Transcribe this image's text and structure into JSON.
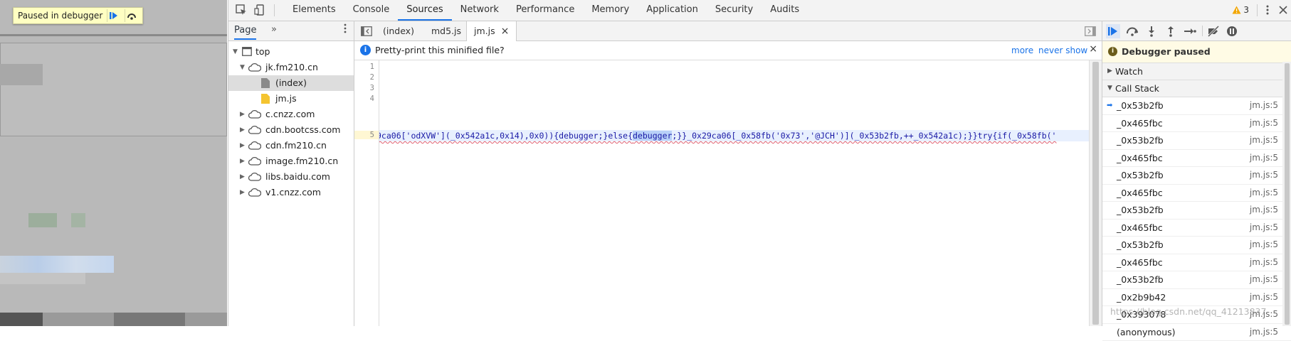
{
  "page_overlay": {
    "paused_label": "Paused in debugger"
  },
  "devtools": {
    "main_tabs": [
      "Elements",
      "Console",
      "Sources",
      "Network",
      "Performance",
      "Memory",
      "Application",
      "Security",
      "Audits"
    ],
    "active_tab": "Sources",
    "warning_count": "3"
  },
  "navigator": {
    "tab_page": "Page",
    "tab_more": "»",
    "tree": {
      "top": "top",
      "domain_open": "jk.fm210.cn",
      "file_index": "(index)",
      "file_jm": "jm.js",
      "d1": "c.cnzz.com",
      "d2": "cdn.bootcss.com",
      "d3": "cdn.fm210.cn",
      "d4": "image.fm210.cn",
      "d5": "libs.baidu.com",
      "d6": "v1.cnzz.com"
    }
  },
  "editor": {
    "tab_index": "(index)",
    "tab_md5": "md5.js",
    "tab_jm": "jm.js",
    "close_glyph": "×",
    "infobar": {
      "message": "Pretty-print this minified file?",
      "more": "more",
      "never_show": "never show",
      "close_glyph": "×"
    },
    "line_numbers": [
      "1",
      "2",
      "3",
      "4",
      "5"
    ],
    "code_before": "9ca06['odXVW'](_0x542a1c,0x14),0x0)){debugger;}else{",
    "code_highlight": "debugger",
    "code_after": ";}}_0x29ca06[_0x58fb('0x73','@JCH')](_0x53b2fb,++_0x542a1c);}}try{if(_0x58fb('"
  },
  "debugger": {
    "paused_title": "Debugger paused",
    "watch_label": "Watch",
    "callstack_label": "Call Stack",
    "frames": [
      {
        "fn": "_0x53b2fb",
        "loc": "jm.js:5"
      },
      {
        "fn": "_0x465fbc",
        "loc": "jm.js:5"
      },
      {
        "fn": "_0x53b2fb",
        "loc": "jm.js:5"
      },
      {
        "fn": "_0x465fbc",
        "loc": "jm.js:5"
      },
      {
        "fn": "_0x53b2fb",
        "loc": "jm.js:5"
      },
      {
        "fn": "_0x465fbc",
        "loc": "jm.js:5"
      },
      {
        "fn": "_0x53b2fb",
        "loc": "jm.js:5"
      },
      {
        "fn": "_0x465fbc",
        "loc": "jm.js:5"
      },
      {
        "fn": "_0x53b2fb",
        "loc": "jm.js:5"
      },
      {
        "fn": "_0x465fbc",
        "loc": "jm.js:5"
      },
      {
        "fn": "_0x53b2fb",
        "loc": "jm.js:5"
      },
      {
        "fn": "_0x2b9b42",
        "loc": "jm.js:5"
      },
      {
        "fn": "_0x393078",
        "loc": "jm.js:5"
      },
      {
        "fn": "(anonymous)",
        "loc": "jm.js:5"
      }
    ]
  },
  "watermark": "https://blog.csdn.net/qq_41213837"
}
